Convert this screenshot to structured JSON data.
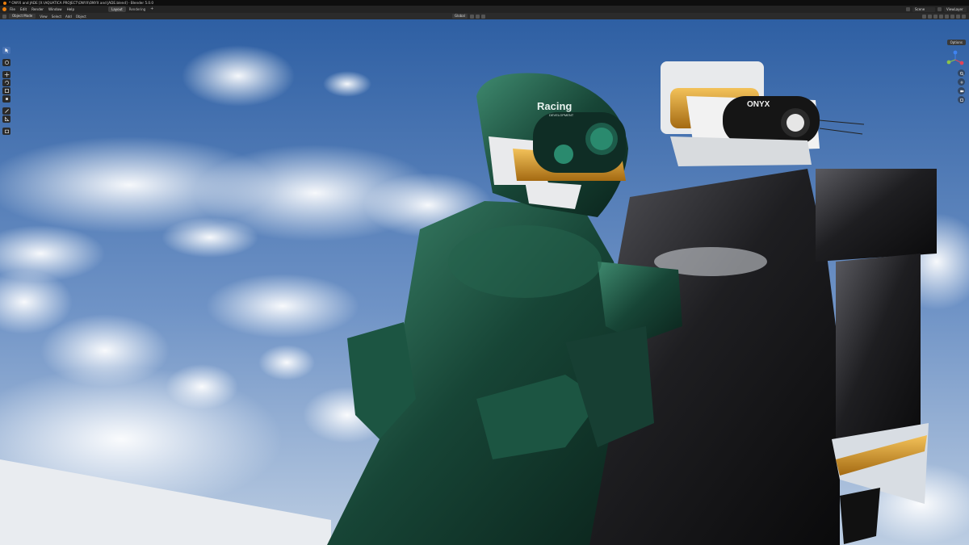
{
  "titlebar": {
    "title": "* ONYX and JADE [X:\\AQUATICA PROJECT\\ONYX\\ONYX and JADE.blend] - Blender 5.0.0"
  },
  "menubar": {
    "items": [
      "File",
      "Edit",
      "Render",
      "Window",
      "Help"
    ],
    "workspaces": [
      "Layout",
      "Rendering"
    ],
    "active_workspace": "Layout",
    "add_tab": "+",
    "scene": "Scene",
    "view_layer": "ViewLayer"
  },
  "header": {
    "mode": "Object Mode",
    "menus": [
      "View",
      "Select",
      "Add",
      "Object"
    ],
    "orientation": "Global",
    "options": "Options"
  },
  "icons": {
    "toolbar": [
      "select-box-icon",
      "cursor-icon",
      "move-icon",
      "rotate-icon",
      "scale-icon",
      "transform-icon",
      "annotate-icon",
      "measure-icon",
      "add-cube-icon"
    ],
    "navigation": [
      "zoom-icon",
      "pan-icon",
      "camera-view-icon",
      "perspective-toggle-icon"
    ]
  },
  "colors": {
    "accent": "#4772b3",
    "blender_orange": "#e87d0d",
    "sky_top": "#2e5fa3",
    "sky_bottom": "#aec3dd",
    "jade": "#1d4f3f",
    "onyx": "#1c1c1e",
    "gizmo_x": "#e0435a",
    "gizmo_y": "#8bc34a",
    "gizmo_z": "#3f83f0"
  },
  "scene": {
    "helmet_logo_jade": "Racing",
    "helmet_logo_jade_sub": "DEVELOPMENT",
    "helmet_logo_onyx": "ONYX"
  }
}
